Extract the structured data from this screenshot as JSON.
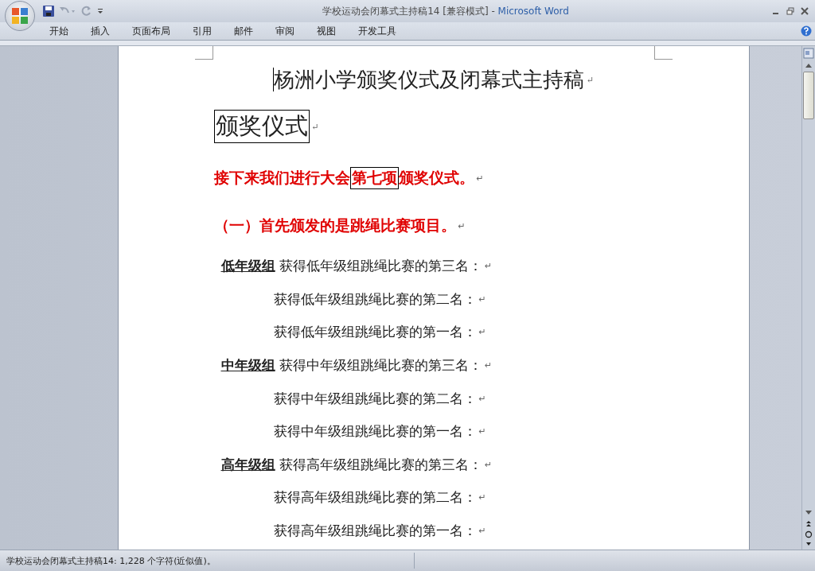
{
  "window": {
    "title": "学校运动会闭幕式主持稿14 [兼容模式]",
    "app_name": "Microsoft Word",
    "separator": "-"
  },
  "ribbon_tabs": [
    {
      "label": "开始",
      "selected": false
    },
    {
      "label": "插入",
      "selected": false
    },
    {
      "label": "页面布局",
      "selected": false
    },
    {
      "label": "引用",
      "selected": false
    },
    {
      "label": "邮件",
      "selected": false
    },
    {
      "label": "审阅",
      "selected": false
    },
    {
      "label": "视图",
      "selected": false
    },
    {
      "label": "开发工具",
      "selected": false
    }
  ],
  "document": {
    "paragraphs": [
      {
        "kind": "title",
        "parts": [
          {
            "text": "杨洲小学颁奖仪式及闭幕式主持稿",
            "boxed": false
          }
        ],
        "mark": "↵"
      },
      {
        "kind": "heading",
        "parts": [
          {
            "text": "颁奖仪式",
            "boxed": true
          }
        ],
        "mark": "↵"
      },
      {
        "kind": "red",
        "parts": [
          {
            "text": "接下来我们进行大会",
            "boxed": false
          },
          {
            "text": "第七项",
            "boxed": true
          },
          {
            "text": "颁奖仪式。",
            "boxed": false
          }
        ],
        "mark": "↵"
      },
      {
        "kind": "red2",
        "parts": [
          {
            "text": "（一）首先颁发的是跳绳比赛项目。",
            "boxed": false
          }
        ],
        "mark": "↵"
      },
      {
        "kind": "group",
        "label": "低年级组",
        "parts": [
          {
            "text": " 获得低年级组跳绳比赛的第三名：",
            "boxed": false
          }
        ],
        "mark": "↵"
      },
      {
        "kind": "sub",
        "parts": [
          {
            "text": "获得低年级组跳绳比赛的第二名：",
            "boxed": false
          }
        ],
        "mark": "↵"
      },
      {
        "kind": "sub",
        "parts": [
          {
            "text": "获得低年级组跳绳比赛的第一名：",
            "boxed": false
          }
        ],
        "mark": "↵"
      },
      {
        "kind": "group",
        "label": "中年级组",
        "parts": [
          {
            "text": " 获得中年级组跳绳比赛的第三名：",
            "boxed": false
          }
        ],
        "mark": "↵"
      },
      {
        "kind": "sub",
        "parts": [
          {
            "text": "获得中年级组跳绳比赛的第二名：",
            "boxed": false
          }
        ],
        "mark": "↵"
      },
      {
        "kind": "sub",
        "parts": [
          {
            "text": "获得中年级组跳绳比赛的第一名：",
            "boxed": false
          }
        ],
        "mark": "↵"
      },
      {
        "kind": "group",
        "label": "高年级组",
        "parts": [
          {
            "text": " 获得高年级组跳绳比赛的第三名：",
            "boxed": false
          }
        ],
        "mark": "↵"
      },
      {
        "kind": "sub",
        "parts": [
          {
            "text": "获得高年级组跳绳比赛的第二名：",
            "boxed": false
          }
        ],
        "mark": "↵"
      },
      {
        "kind": "sub",
        "parts": [
          {
            "text": "获得高年级组跳绳比赛的第一名：",
            "boxed": false
          }
        ],
        "mark": "↵"
      }
    ]
  },
  "status_bar": {
    "text": "学校运动会闭幕式主持稿14: 1,228 个字符(近似值)。"
  }
}
